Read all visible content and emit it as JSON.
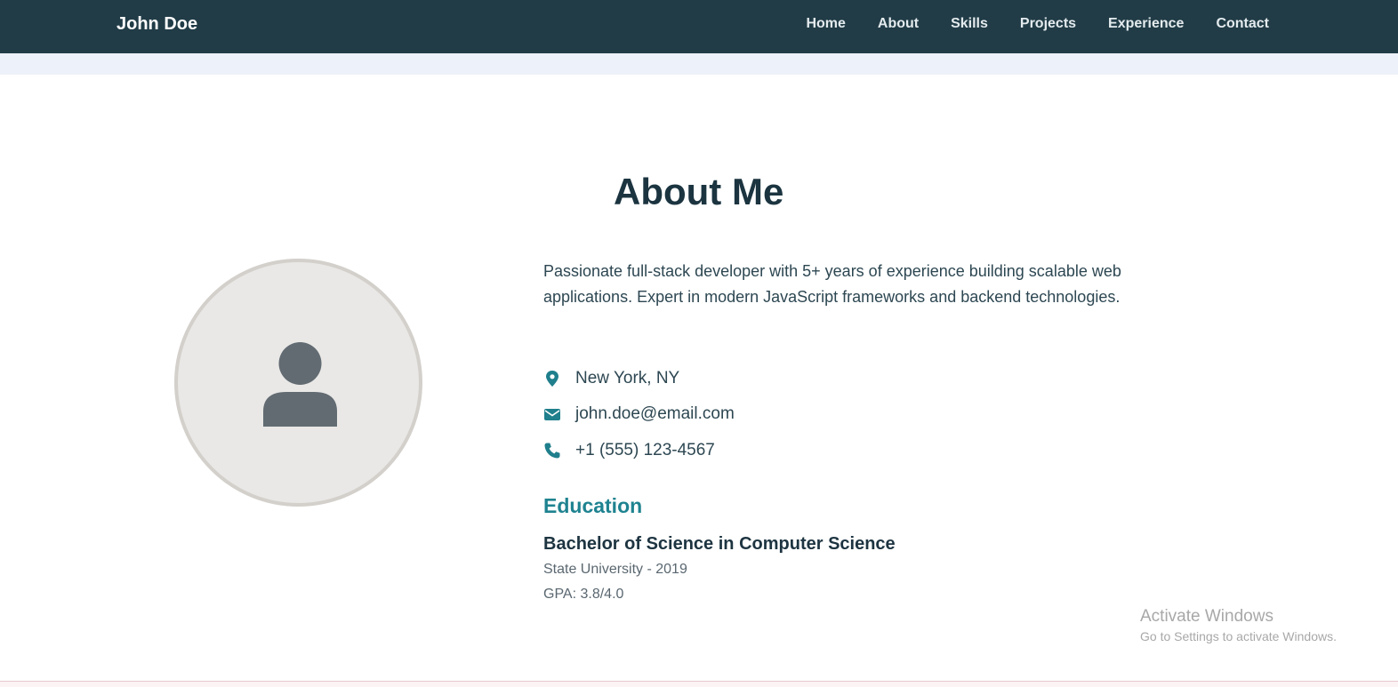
{
  "nav": {
    "brand": "John Doe",
    "links": [
      "Home",
      "About",
      "Skills",
      "Projects",
      "Experience",
      "Contact"
    ]
  },
  "about": {
    "title": "About Me",
    "bio": "Passionate full-stack developer with 5+ years of experience building scalable web applications. Expert in modern JavaScript frameworks and backend technologies.",
    "contacts": [
      {
        "icon": "location-pin-icon",
        "text": "New York, NY"
      },
      {
        "icon": "envelope-icon",
        "text": "john.doe@email.com"
      },
      {
        "icon": "phone-icon",
        "text": "+1 (555) 123-4567"
      }
    ]
  },
  "education": {
    "title": "Education",
    "degree": "Bachelor of Science in Computer Science",
    "school": "State University - 2019",
    "gpa": "GPA: 3.8/4.0"
  },
  "watermark": {
    "title": "Activate Windows",
    "subtitle": "Go to Settings to activate Windows."
  },
  "colors": {
    "navbar": "#213c47",
    "accent": "#1f8390",
    "heading": "#1b3440"
  }
}
